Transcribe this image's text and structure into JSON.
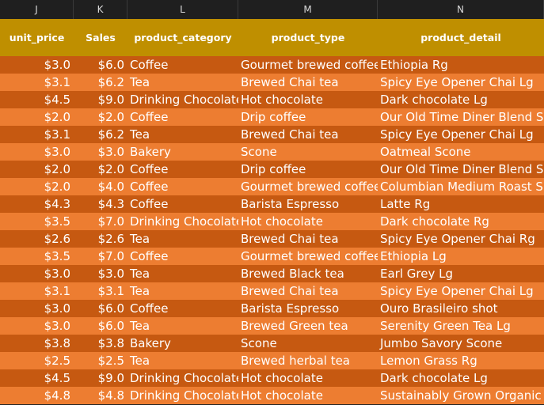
{
  "columns": [
    {
      "letter": "J",
      "header": "unit_price"
    },
    {
      "letter": "K",
      "header": "Sales"
    },
    {
      "letter": "L",
      "header": "product_category"
    },
    {
      "letter": "M",
      "header": "product_type"
    },
    {
      "letter": "N",
      "header": "product_detail"
    }
  ],
  "colors": {
    "header_bg": "#bf8f00",
    "row_dark": "#c65911",
    "row_light": "#ed7d31",
    "text": "#ffffff"
  },
  "rows": [
    [
      "$3.0",
      "$6.0",
      "Coffee",
      "Gourmet brewed coffee",
      "Ethiopia Rg"
    ],
    [
      "$3.1",
      "$6.2",
      "Tea",
      "Brewed Chai tea",
      "Spicy Eye Opener Chai Lg"
    ],
    [
      "$4.5",
      "$9.0",
      "Drinking Chocolate",
      "Hot chocolate",
      "Dark chocolate Lg"
    ],
    [
      "$2.0",
      "$2.0",
      "Coffee",
      "Drip coffee",
      "Our Old Time Diner Blend Sm"
    ],
    [
      "$3.1",
      "$6.2",
      "Tea",
      "Brewed Chai tea",
      "Spicy Eye Opener Chai Lg"
    ],
    [
      "$3.0",
      "$3.0",
      "Bakery",
      "Scone",
      "Oatmeal Scone"
    ],
    [
      "$2.0",
      "$2.0",
      "Coffee",
      "Drip coffee",
      "Our Old Time Diner Blend Sm"
    ],
    [
      "$2.0",
      "$4.0",
      "Coffee",
      "Gourmet brewed coffee",
      "Columbian Medium Roast Sm"
    ],
    [
      "$4.3",
      "$4.3",
      "Coffee",
      "Barista Espresso",
      "Latte Rg"
    ],
    [
      "$3.5",
      "$7.0",
      "Drinking Chocolate",
      "Hot chocolate",
      "Dark chocolate Rg"
    ],
    [
      "$2.6",
      "$2.6",
      "Tea",
      "Brewed Chai tea",
      "Spicy Eye Opener Chai Rg"
    ],
    [
      "$3.5",
      "$7.0",
      "Coffee",
      "Gourmet brewed coffee",
      "Ethiopia Lg"
    ],
    [
      "$3.0",
      "$3.0",
      "Tea",
      "Brewed Black tea",
      "Earl Grey Lg"
    ],
    [
      "$3.1",
      "$3.1",
      "Tea",
      "Brewed Chai tea",
      "Spicy Eye Opener Chai Lg"
    ],
    [
      "$3.0",
      "$6.0",
      "Coffee",
      "Barista Espresso",
      "Ouro Brasileiro shot"
    ],
    [
      "$3.0",
      "$6.0",
      "Tea",
      "Brewed Green tea",
      "Serenity Green Tea Lg"
    ],
    [
      "$3.8",
      "$3.8",
      "Bakery",
      "Scone",
      "Jumbo Savory Scone"
    ],
    [
      "$2.5",
      "$2.5",
      "Tea",
      "Brewed herbal tea",
      "Lemon Grass Rg"
    ],
    [
      "$4.5",
      "$9.0",
      "Drinking Chocolate",
      "Hot chocolate",
      "Dark chocolate Lg"
    ],
    [
      "$4.8",
      "$4.8",
      "Drinking Chocolate",
      "Hot chocolate",
      "Sustainably Grown Organic Lg"
    ]
  ]
}
